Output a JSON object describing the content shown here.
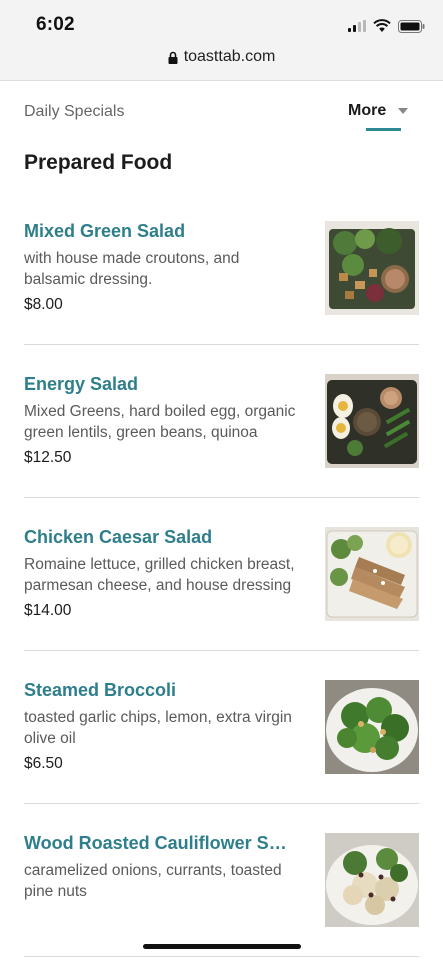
{
  "status_bar": {
    "time": "6:02"
  },
  "browser": {
    "url": "toasttab.com"
  },
  "category_nav": {
    "current": "Daily Specials",
    "more_label": "More"
  },
  "section": {
    "title": "Prepared Food"
  },
  "items": [
    {
      "name": "Mixed Green Salad",
      "description": "with house made croutons, and balsamic dressing.",
      "price": "$8.00",
      "photo": "mixed-green-salad-photo"
    },
    {
      "name": "Energy Salad",
      "description": "Mixed Greens, hard boiled egg, organic green lentils, green beans, quinoa",
      "price": "$12.50",
      "photo": "energy-salad-photo"
    },
    {
      "name": "Chicken Caesar Salad",
      "description": "Romaine lettuce, grilled chicken breast, parmesan cheese, and house dressing",
      "price": "$14.00",
      "photo": "chicken-caesar-salad-photo"
    },
    {
      "name": "Steamed Broccoli",
      "description": "toasted garlic chips, lemon, extra virgin olive oil",
      "price": "$6.50",
      "photo": "steamed-broccoli-photo"
    },
    {
      "name": "Wood Roasted Cauliflower Salad",
      "description": "caramelized onions, currants, toasted pine nuts",
      "price": "",
      "photo": "cauliflower-salad-photo"
    }
  ],
  "colors": {
    "accent": "#2e7f8c",
    "underline": "#2e8a96"
  }
}
